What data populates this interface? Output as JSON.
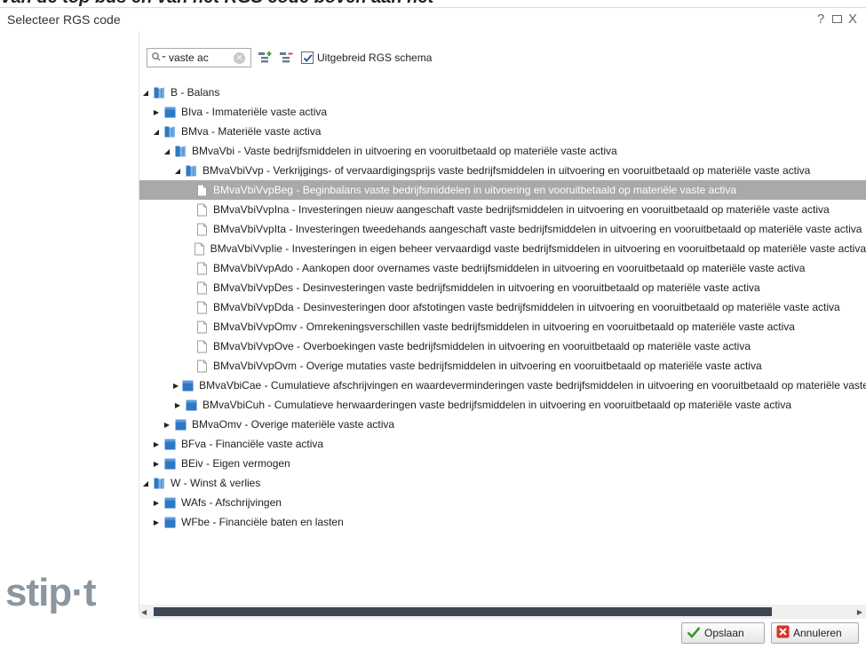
{
  "header_strip": "Van de top bus en van het RGS code boven aan het",
  "dialog": {
    "title": "Selecteer RGS code",
    "help_label": "?",
    "close_label": "X"
  },
  "toolbar": {
    "search_value": "vaste ac",
    "extended_schema_label": "Uitgebreid RGS schema",
    "extended_schema_checked": true
  },
  "tree": {
    "rows": [
      {
        "label": "B - Balans",
        "level": 0,
        "toggle": "expanded",
        "icon": "folder-open-icon"
      },
      {
        "label": "BIva - Immateriële vaste activa",
        "level": 1,
        "toggle": "collapsed",
        "icon": "folder-icon"
      },
      {
        "label": "BMva - Materiële vaste activa",
        "level": 1,
        "toggle": "expanded",
        "icon": "folder-open-icon"
      },
      {
        "label": "BMvaVbi - Vaste bedrijfsmiddelen in uitvoering en vooruitbetaald op materiële vaste activa",
        "level": 2,
        "toggle": "expanded",
        "icon": "folder-open-icon"
      },
      {
        "label": "BMvaVbiVvp - Verkrijgings- of vervaardigingsprijs vaste bedrijfsmiddelen in uitvoering en vooruitbetaald op materiële vaste activa",
        "level": 3,
        "toggle": "expanded",
        "icon": "folder-open-icon"
      },
      {
        "label": "BMvaVbiVvpBeg - Beginbalans vaste bedrijfsmiddelen in uitvoering en vooruitbetaald op materiële vaste activa",
        "level": 4,
        "toggle": "none",
        "icon": "document-icon",
        "selected": true
      },
      {
        "label": "BMvaVbiVvpIna - Investeringen nieuw aangeschaft vaste bedrijfsmiddelen in uitvoering en vooruitbetaald op materiële vaste activa",
        "level": 4,
        "toggle": "none",
        "icon": "document-icon"
      },
      {
        "label": "BMvaVbiVvpIta - Investeringen tweedehands aangeschaft vaste bedrijfsmiddelen in uitvoering en vooruitbetaald op materiële vaste activa",
        "level": 4,
        "toggle": "none",
        "icon": "document-icon"
      },
      {
        "label": "BMvaVbiVvpIie - Investeringen in eigen beheer vervaardigd vaste bedrijfsmiddelen in uitvoering en vooruitbetaald op materiële vaste activa",
        "level": 4,
        "toggle": "none",
        "icon": "document-icon"
      },
      {
        "label": "BMvaVbiVvpAdo - Aankopen door overnames vaste bedrijfsmiddelen in uitvoering en vooruitbetaald op materiële vaste activa",
        "level": 4,
        "toggle": "none",
        "icon": "document-icon"
      },
      {
        "label": "BMvaVbiVvpDes - Desinvesteringen vaste bedrijfsmiddelen in uitvoering en vooruitbetaald op materiële vaste activa",
        "level": 4,
        "toggle": "none",
        "icon": "document-icon"
      },
      {
        "label": "BMvaVbiVvpDda - Desinvesteringen door afstotingen vaste bedrijfsmiddelen in uitvoering en vooruitbetaald op materiële vaste activa",
        "level": 4,
        "toggle": "none",
        "icon": "document-icon"
      },
      {
        "label": "BMvaVbiVvpOmv - Omrekeningsverschillen vaste bedrijfsmiddelen in uitvoering en vooruitbetaald op materiële vaste activa",
        "level": 4,
        "toggle": "none",
        "icon": "document-icon"
      },
      {
        "label": "BMvaVbiVvpOve - Overboekingen vaste bedrijfsmiddelen in uitvoering en vooruitbetaald op materiële vaste activa",
        "level": 4,
        "toggle": "none",
        "icon": "document-icon"
      },
      {
        "label": "BMvaVbiVvpOvm - Overige mutaties vaste bedrijfsmiddelen in uitvoering en vooruitbetaald op materiële vaste activa",
        "level": 4,
        "toggle": "none",
        "icon": "document-icon"
      },
      {
        "label": "BMvaVbiCae - Cumulatieve afschrijvingen en waardeverminderingen vaste bedrijfsmiddelen in uitvoering en vooruitbetaald op materiële vaste activa",
        "level": 3,
        "toggle": "collapsed",
        "icon": "folder-icon"
      },
      {
        "label": "BMvaVbiCuh - Cumulatieve herwaarderingen vaste bedrijfsmiddelen in uitvoering en vooruitbetaald op materiële vaste activa",
        "level": 3,
        "toggle": "collapsed",
        "icon": "folder-icon"
      },
      {
        "label": "BMvaOmv - Overige materiële vaste activa",
        "level": 2,
        "toggle": "collapsed",
        "icon": "folder-icon"
      },
      {
        "label": "BFva - Financiële vaste activa",
        "level": 1,
        "toggle": "collapsed",
        "icon": "folder-icon"
      },
      {
        "label": "BEiv - Eigen vermogen",
        "level": 1,
        "toggle": "collapsed",
        "icon": "folder-icon"
      },
      {
        "label": "W - Winst & verlies",
        "level": 0,
        "toggle": "expanded",
        "icon": "folder-open-icon"
      },
      {
        "label": "WAfs - Afschrijvingen",
        "level": 1,
        "toggle": "collapsed",
        "icon": "folder-icon"
      },
      {
        "label": "WFbe - Financiële baten en lasten",
        "level": 1,
        "toggle": "collapsed",
        "icon": "folder-icon"
      }
    ]
  },
  "brand": {
    "logo_text": "stip·t"
  },
  "footer": {
    "save_label": "Opslaan",
    "cancel_label": "Annuleren"
  },
  "colors": {
    "selected_row": "#a9a9a9",
    "folder_blue": "#2f78c4",
    "scroll_thumb": "#3d4752",
    "logo_gray": "#8b96a0"
  }
}
